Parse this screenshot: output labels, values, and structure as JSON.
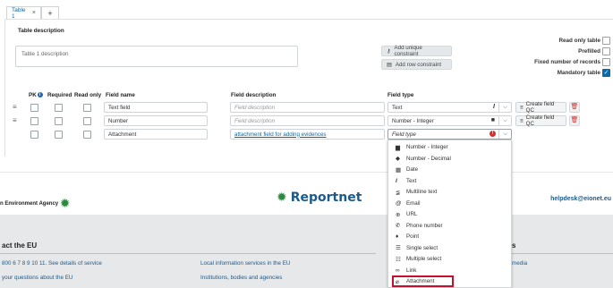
{
  "tabs": [
    {
      "label": "Table 1",
      "close": "×"
    },
    {
      "label": "+"
    }
  ],
  "description": {
    "label": "Table description",
    "value": "Table 1 description"
  },
  "constraints": {
    "unique_label": "Add unique constraint",
    "row_label": "Add row constraint"
  },
  "options": [
    {
      "label": "Read only table",
      "checked": false
    },
    {
      "label": "Prefilled",
      "checked": false
    },
    {
      "label": "Fixed number of records",
      "checked": false
    },
    {
      "label": "Mandatory table",
      "checked": true,
      "mark": "✓"
    }
  ],
  "columns": {
    "pk": "PK",
    "info": "i",
    "required": "Required",
    "read_only": "Read only",
    "field_name": "Field name",
    "field_description": "Field description",
    "field_type": "Field type"
  },
  "rows": [
    {
      "name": "Text field",
      "description": "Field description",
      "type": "Text",
      "type_icon": "I",
      "qc": "Create field QC"
    },
    {
      "name": "Number",
      "description": "Field description",
      "type": "Number - Integer",
      "type_icon": "■",
      "qc": "Create field QC"
    },
    {
      "name": "Attachment",
      "description": "attachment field for adding evidences",
      "type": "Field type",
      "type_icon": "!"
    }
  ],
  "dropdown": [
    {
      "icon": "▆",
      "label": "Number - Integer"
    },
    {
      "icon": "◆",
      "label": "Number - Decimal"
    },
    {
      "icon": "▦",
      "label": "Date"
    },
    {
      "icon": "I",
      "label": "Text"
    },
    {
      "icon": "≨",
      "label": "Multiline text"
    },
    {
      "icon": "@",
      "label": "Email"
    },
    {
      "icon": "⊕",
      "label": "URL"
    },
    {
      "icon": "✆",
      "label": "Phone number"
    },
    {
      "icon": "♦",
      "label": "Point"
    },
    {
      "icon": "☰",
      "label": "Single select"
    },
    {
      "icon": "☷",
      "label": "Multiple select"
    },
    {
      "icon": "∞",
      "label": "Link"
    },
    {
      "icon": "⌀",
      "label": "Attachment"
    }
  ],
  "footer": {
    "agency": "n Environment Agency",
    "brand": "Reportnet",
    "helpdesk": "helpdesk@eionet.eu",
    "contact_heading": "act the EU",
    "links_left": [
      "800 6 7 8 9 10 11. See details of service",
      "your questions about the EU"
    ],
    "links_mid": [
      "Local information services in the EU",
      "Institutions, bodies and agencies"
    ],
    "heading_right": "s",
    "link_right": "media"
  },
  "colors": {
    "accent": "#0a6aa6",
    "brand": "#1d5a8c",
    "danger": "#d32f2f",
    "highlight": "#c8102e"
  }
}
